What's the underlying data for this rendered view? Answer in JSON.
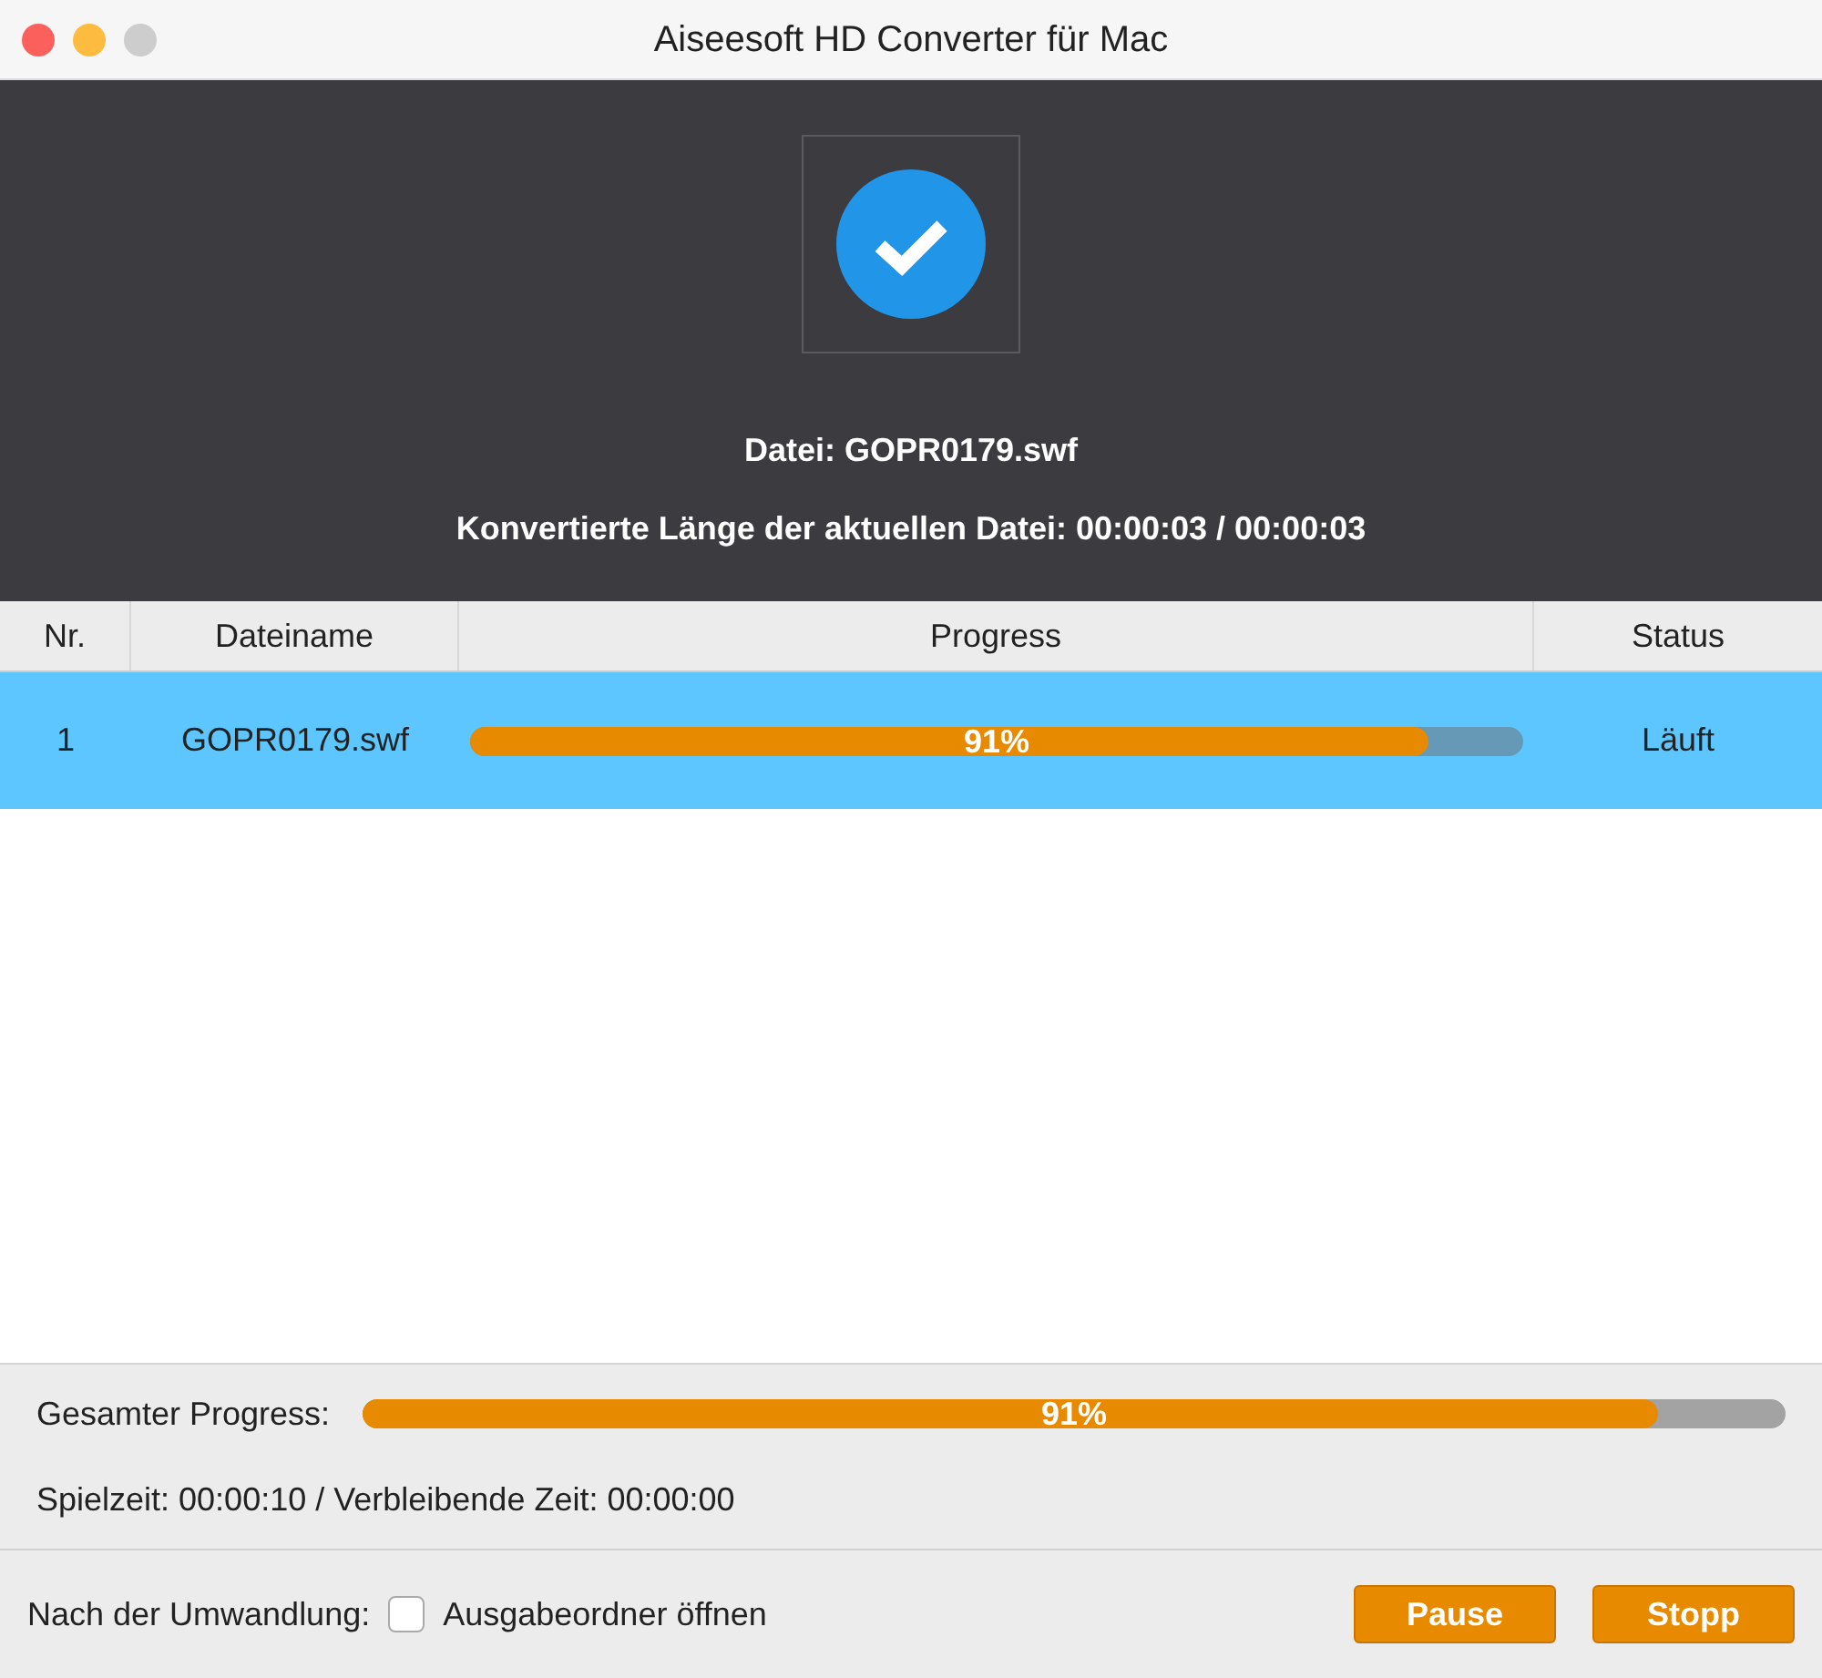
{
  "window": {
    "title": "Aiseesoft HD Converter für Mac"
  },
  "current": {
    "file": "Datei: GOPR0179.swf",
    "length": "Konvertierte Länge der aktuellen Datei: 00:00:03 / 00:00:03"
  },
  "table": {
    "columns": [
      "Nr.",
      "Dateiname",
      "Progress",
      "Status"
    ],
    "rows": [
      {
        "nr": "1",
        "name": "GOPR0179.swf",
        "level": 0.91,
        "percent": "91%",
        "status": "Läuft",
        "selected": true
      }
    ]
  },
  "total": {
    "label": "Gesamter Progress:",
    "level": 0.91,
    "percent": "91%",
    "times": "Spielzeit: 00:00:10 / Verbleibende Zeit: 00:00:00"
  },
  "footer": {
    "label": "Nach der Umwandlung:",
    "checkbox": {
      "label": "Ausgabeordner öffnen",
      "checked": false
    },
    "buttons": [
      "Pause",
      "Stopp"
    ]
  }
}
